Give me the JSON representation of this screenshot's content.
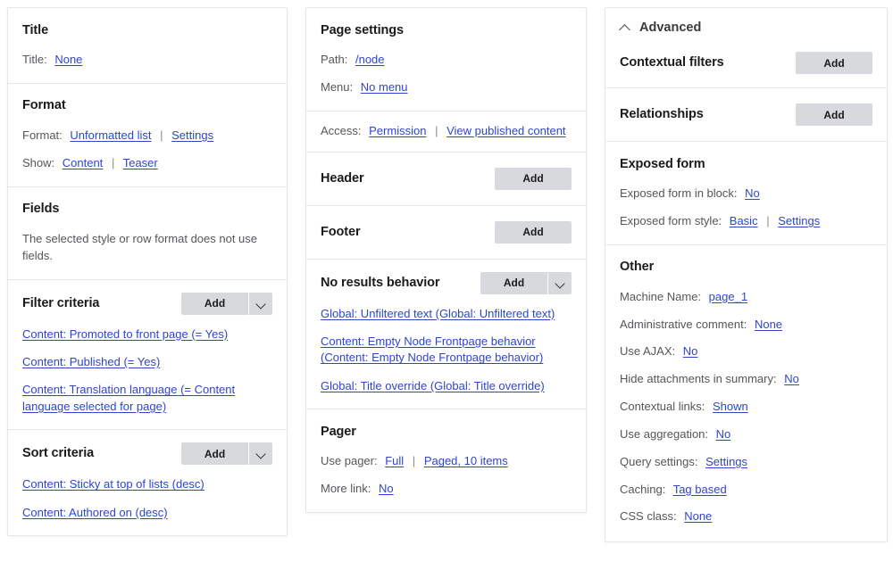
{
  "left_column": {
    "title_section": {
      "heading": "Title",
      "rows": [
        {
          "label": "Title:",
          "links": [
            "None"
          ]
        }
      ]
    },
    "format_section": {
      "heading": "Format",
      "rows": [
        {
          "label": "Format:",
          "links": [
            "Unformatted list",
            "Settings"
          ]
        },
        {
          "label": "Show:",
          "links": [
            "Content",
            "Teaser"
          ]
        }
      ]
    },
    "fields_section": {
      "heading": "Fields",
      "note": "The selected style or row format does not use fields."
    },
    "filter_criteria": {
      "heading": "Filter criteria",
      "add_label": "Add",
      "has_dropdown": true,
      "items": [
        "Content: Promoted to front page (= Yes)",
        "Content: Published (= Yes)",
        "Content: Translation language (= Content language selected for page)"
      ]
    },
    "sort_criteria": {
      "heading": "Sort criteria",
      "add_label": "Add",
      "has_dropdown": true,
      "items": [
        "Content: Sticky at top of lists (desc)",
        "Content: Authored on (desc)"
      ]
    }
  },
  "middle_column": {
    "page_settings": {
      "heading": "Page settings",
      "rows": [
        {
          "label": "Path:",
          "links": [
            "/node"
          ]
        },
        {
          "label": "Menu:",
          "links": [
            "No menu"
          ]
        }
      ]
    },
    "access_section": {
      "rows": [
        {
          "label": "Access:",
          "links": [
            "Permission",
            "View published content"
          ]
        }
      ]
    },
    "header_section": {
      "heading": "Header",
      "add_label": "Add",
      "has_dropdown": false
    },
    "footer_section": {
      "heading": "Footer",
      "add_label": "Add",
      "has_dropdown": false
    },
    "no_results_behavior": {
      "heading": "No results behavior",
      "add_label": "Add",
      "has_dropdown": true,
      "items": [
        "Global: Unfiltered text (Global: Unfiltered text)",
        "Content: Empty Node Frontpage behavior (Content: Empty Node Frontpage behavior)",
        "Global: Title override (Global: Title override)"
      ]
    },
    "pager": {
      "heading": "Pager",
      "rows": [
        {
          "label": "Use pager:",
          "links": [
            "Full",
            "Paged, 10 items"
          ]
        },
        {
          "label": "More link:",
          "links": [
            "No"
          ]
        }
      ]
    }
  },
  "right_column": {
    "advanced": {
      "heading": "Advanced",
      "collapse_icon": "chevron-up-icon"
    },
    "contextual_filters": {
      "heading": "Contextual filters",
      "add_label": "Add",
      "has_dropdown": false
    },
    "relationships": {
      "heading": "Relationships",
      "add_label": "Add",
      "has_dropdown": false
    },
    "exposed_form": {
      "heading": "Exposed form",
      "rows": [
        {
          "label": "Exposed form in block:",
          "links": [
            "No"
          ]
        },
        {
          "label": "Exposed form style:",
          "links": [
            "Basic",
            "Settings"
          ]
        }
      ]
    },
    "other": {
      "heading": "Other",
      "rows": [
        {
          "label": "Machine Name:",
          "links": [
            "page_1"
          ]
        },
        {
          "label": "Administrative comment:",
          "links": [
            "None"
          ]
        },
        {
          "label": "Use AJAX:",
          "links": [
            "No"
          ]
        },
        {
          "label": "Hide attachments in summary:",
          "links": [
            "No"
          ]
        },
        {
          "label": "Contextual links:",
          "links": [
            "Shown"
          ]
        },
        {
          "label": "Use aggregation:",
          "links": [
            "No"
          ]
        },
        {
          "label": "Query settings:",
          "links": [
            "Settings"
          ]
        },
        {
          "label": "Caching:",
          "links": [
            "Tag based"
          ]
        },
        {
          "label": "CSS class:",
          "links": [
            "None"
          ]
        }
      ]
    }
  },
  "colors": {
    "link": "#2f44d0",
    "button_bg": "#d8d9dd",
    "label_text": "#55565a",
    "heading_text": "#1b1b1d",
    "panel_border": "#e6e6e6"
  }
}
